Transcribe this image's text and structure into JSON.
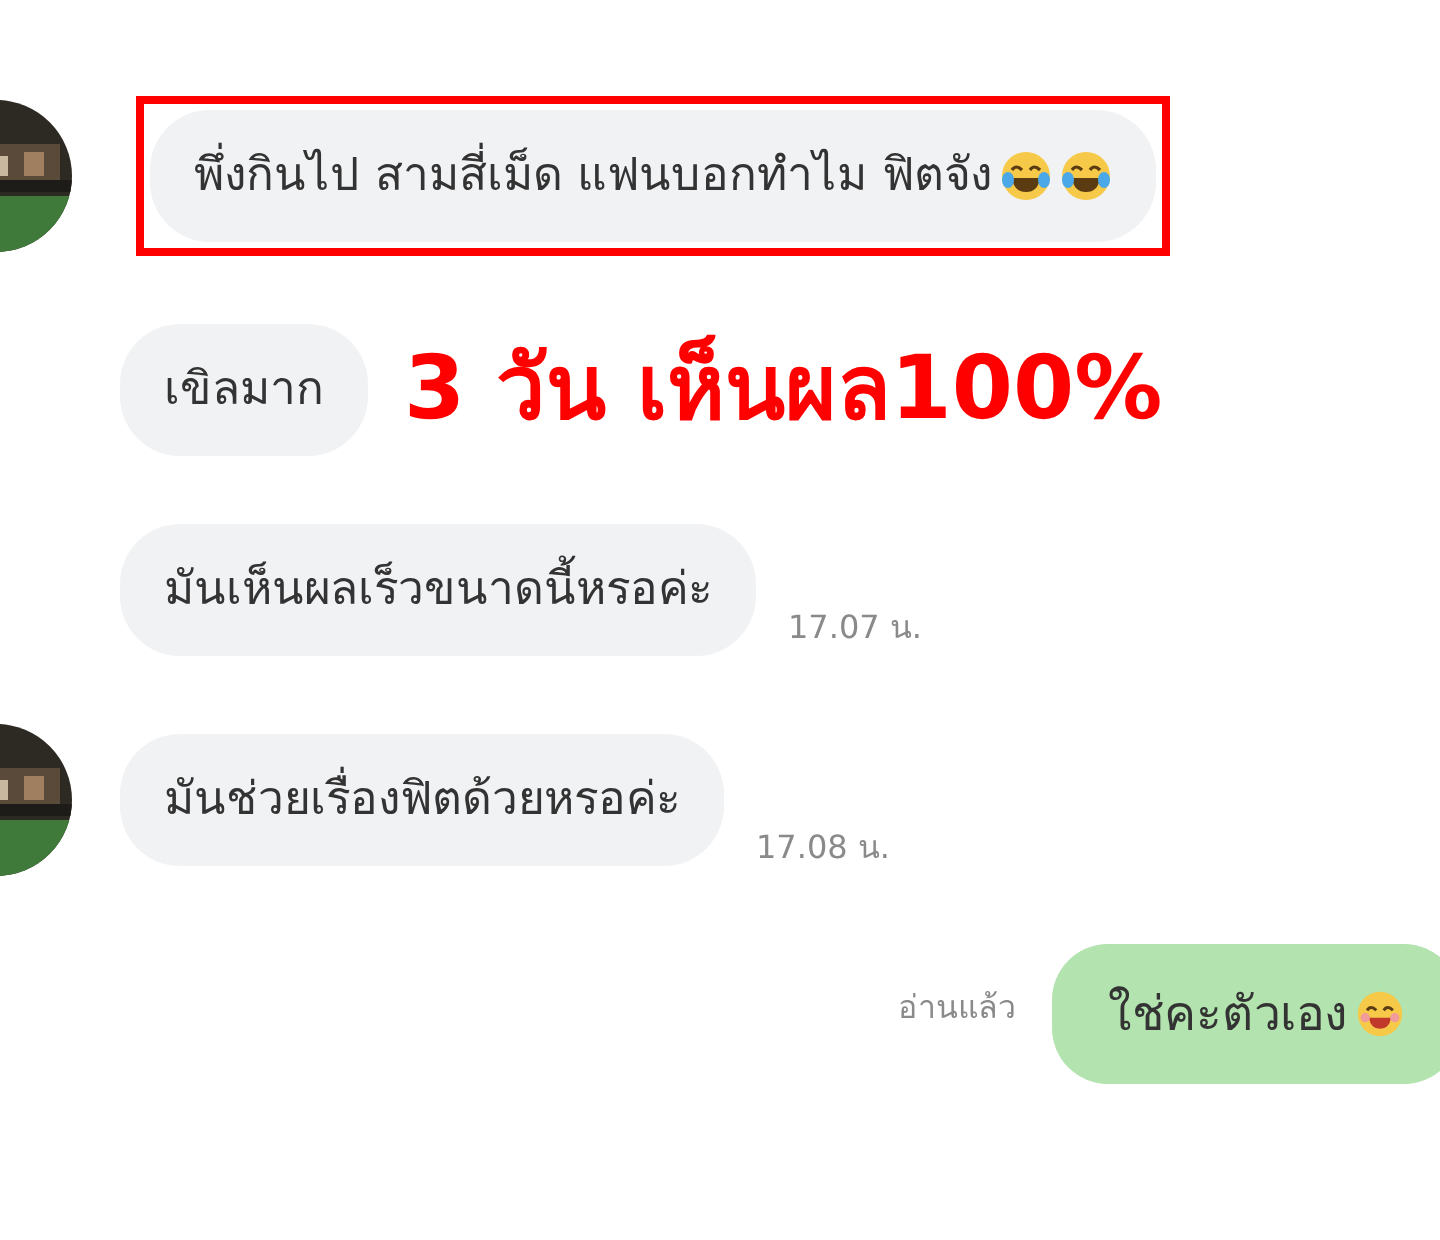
{
  "messages": [
    {
      "kind": "received",
      "avatar": true,
      "highlighted": true,
      "text": "พึ่งกินไป สามสี่เม็ด แฟนบอกทำไม ฟิตจัง",
      "emojis": [
        {
          "kind": "tears-of-joy"
        },
        {
          "kind": "tears-of-joy"
        }
      ]
    },
    {
      "kind": "received",
      "avatar": false,
      "highlighted": false,
      "text": "เขิลมาก",
      "caption": "3 วัน เห็นผล100%"
    },
    {
      "kind": "received",
      "avatar": false,
      "highlighted": false,
      "text": "มันเห็นผลเร็วขนาดนี้หรอค่ะ",
      "time": "17.07 น."
    },
    {
      "kind": "received",
      "avatar": true,
      "highlighted": false,
      "text": "มันช่วยเรื่องฟิตด้วยหรอค่ะ",
      "time": "17.08 น."
    },
    {
      "kind": "sent",
      "read_status": "อ่านแล้ว",
      "text": "ใช่คะตัวเอง",
      "emojis": [
        {
          "kind": "smiling"
        }
      ]
    }
  ]
}
